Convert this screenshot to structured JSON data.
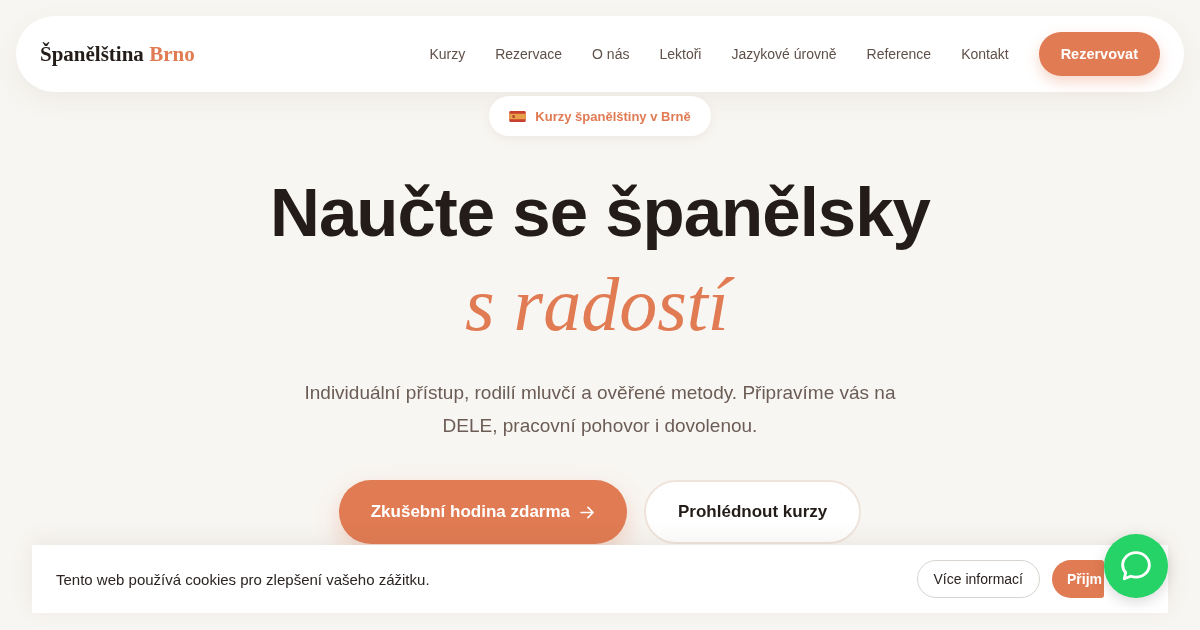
{
  "nav": {
    "logo": {
      "name": "Španělština",
      "accent": "Brno"
    },
    "links": [
      "Kurzy",
      "Rezervace",
      "O nás",
      "Lektoři",
      "Jazykové úrovně",
      "Reference",
      "Kontakt"
    ],
    "cta": "Rezervovat"
  },
  "hero": {
    "badge": "Kurzy španělštiny v Brně",
    "title": "Naučte se španělsky",
    "title_accent": "s radostí",
    "subtitle": "Individuální přístup, rodilí mluvčí a ověřené metody. Připravíme vás na DELE, pracovní pohovor i dovolenou.",
    "buttons": [
      {
        "label": "Zkušební hodina zdarma",
        "kind": "primary"
      },
      {
        "label": "Prohlédnout kurzy",
        "kind": "secondary"
      }
    ]
  },
  "cookie_banner": {
    "text": "Tento web používá cookies pro zlepšení vašeho zážitku.",
    "buttons": [
      {
        "label": "Více informací",
        "kind": "secondary"
      },
      {
        "label": "Přijm",
        "kind": "primary"
      }
    ]
  }
}
